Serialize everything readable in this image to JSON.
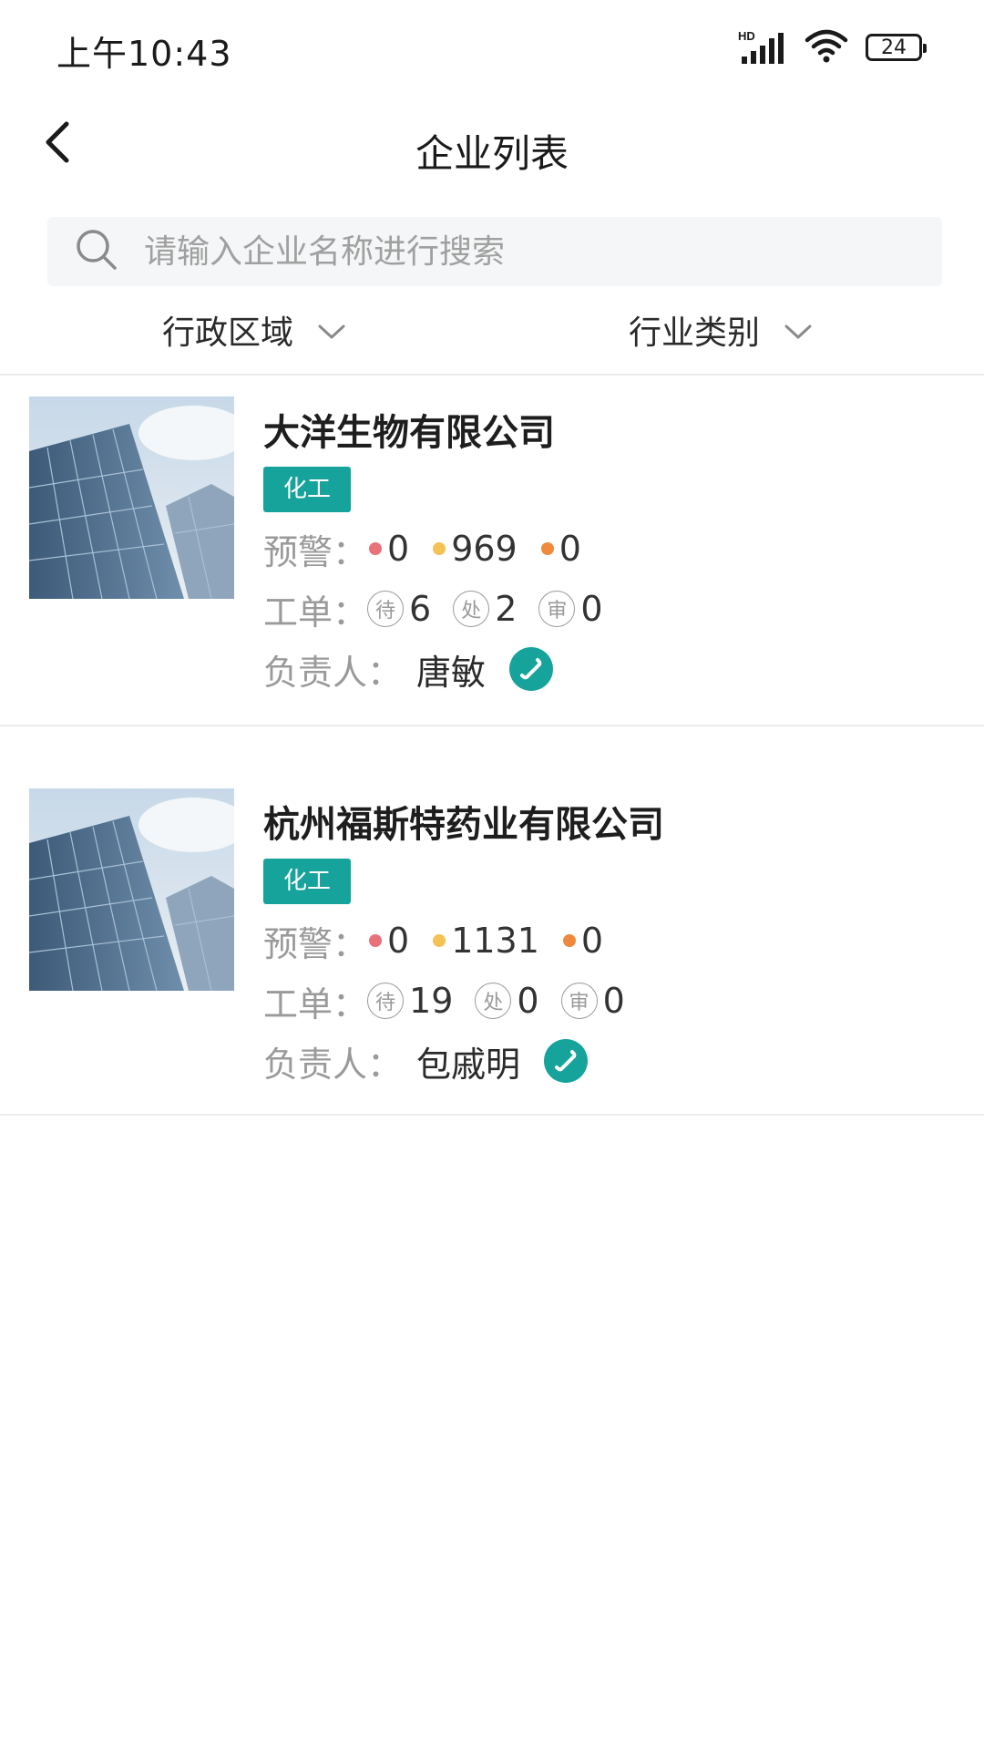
{
  "status_bar": {
    "time": "上午10:43",
    "network_label": "HD",
    "battery": "24"
  },
  "header": {
    "title": "企业列表",
    "back_icon": "chevron-left-icon"
  },
  "search": {
    "placeholder": "请输入企业名称进行搜索",
    "value": "",
    "icon": "search-icon"
  },
  "filters": [
    {
      "label": "行政区域",
      "icon": "chevron-down-icon"
    },
    {
      "label": "行业类别",
      "icon": "chevron-down-icon"
    }
  ],
  "labels": {
    "warning": "预警：",
    "work_order": "工单：",
    "responsible": "负责人：",
    "pending": "待",
    "processing": "处",
    "review": "审"
  },
  "colors": {
    "accent": "#16a39b",
    "warning_red": "#e9727a",
    "warning_yellow": "#f2c255",
    "warning_orange": "#ee8a3d"
  },
  "companies": [
    {
      "name": "大洋生物有限公司",
      "tag": "化工",
      "warnings": {
        "red": "0",
        "yellow": "969",
        "orange": "0"
      },
      "orders": {
        "pending": "6",
        "processing": "2",
        "review": "0"
      },
      "person": "唐敏"
    },
    {
      "name": "杭州福斯特药业有限公司",
      "tag": "化工",
      "warnings": {
        "red": "0",
        "yellow": "1131",
        "orange": "0"
      },
      "orders": {
        "pending": "19",
        "processing": "0",
        "review": "0"
      },
      "person": "包戚明"
    }
  ]
}
